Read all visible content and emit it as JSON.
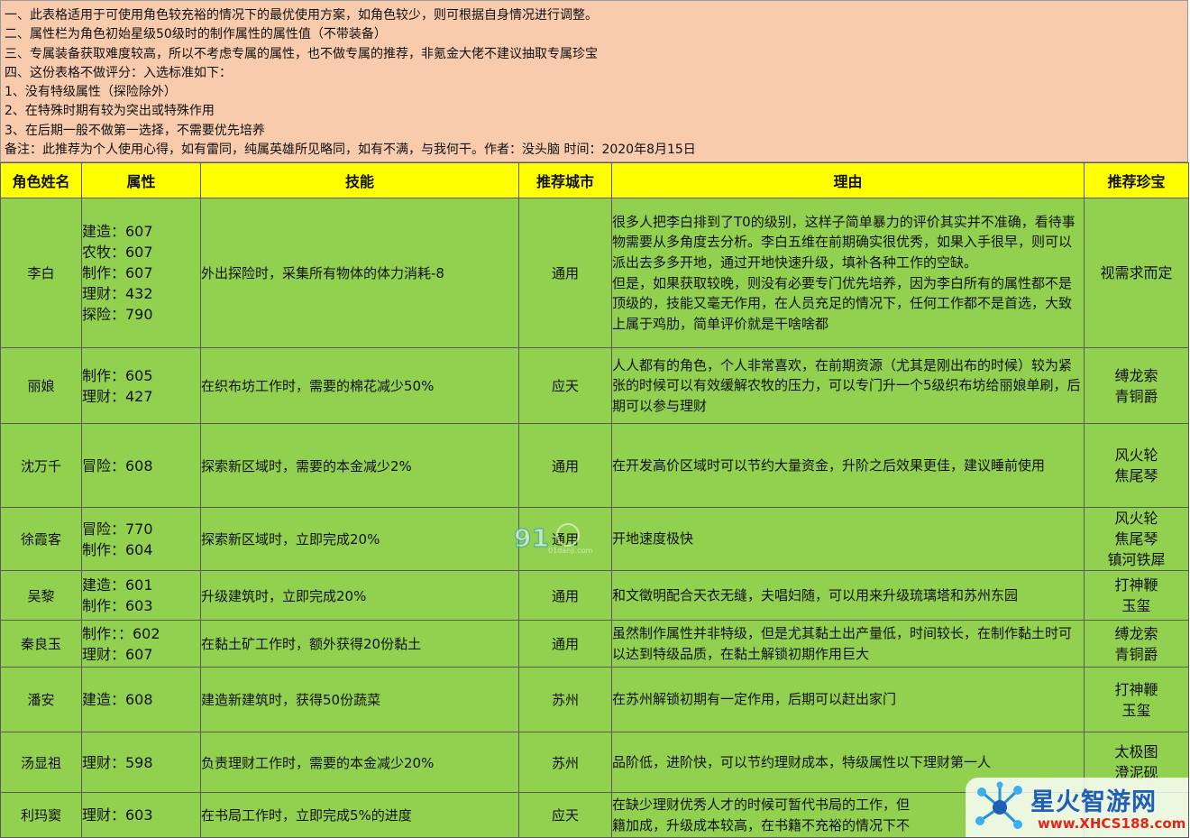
{
  "notes": [
    "一、此表格适用于可使用角色较充裕的情况下的最优使用方案，如角色较少，则可根据自身情况进行调整。",
    "二、属性栏为角色初始星级50级时的制作属性的属性值（不带装备）",
    "三、专属装备获取难度较高，所以不考虑专属的属性，也不做专属的推荐，非氪金大佬不建议抽取专属珍宝",
    "四、这份表格不做评分：入选标准如下：",
    "1、没有特级属性（探险除外）",
    "2、在特殊时期有较为突出或特殊作用",
    "3、在后期一般不做第一选择，不需要优先培养",
    "备注：此推荐为个人使用心得，如有雷同，纯属英雄所见略同，如有不满，与我何干。作者：没头脑  时间：2020年8月15日"
  ],
  "headers": {
    "name": "角色姓名",
    "attr": "属性",
    "skill": "技能",
    "city": "推荐城市",
    "reason": "理由",
    "treasure": "推荐珍宝"
  },
  "rows": [
    {
      "name": "李白",
      "attrs": [
        "建造：607",
        "农牧：607",
        "制作：607",
        "理财：432",
        "探险：790"
      ],
      "skill": "外出探险时，采集所有物体的体力消耗-8",
      "city": "通用",
      "reason": "很多人把李白排到了T0的级别，这样子简单暴力的评价其实并不准确，看待事物需要从多角度去分析。李白五维在前期确实很优秀，如果入手很早，则可以派出去多多开地，通过开地快速升级，填补各种工作的空缺。",
      "reason2": "但是，如果获取较晚，则没有必要专门优先培养，因为李白所有的属性都不是顶级的，技能又毫无作用，在人员充足的情况下，任何工作都不是首选，大致上属于鸡肋，简单评价就是干啥啥都",
      "treasures": [
        "视需求而定"
      ]
    },
    {
      "name": "丽娘",
      "attrs": [
        "制作：605",
        "理财：427"
      ],
      "skill": "在织布坊工作时，需要的棉花减少50%",
      "city": "应天",
      "reason": "人人都有的角色，个人非常喜欢，在前期资源（尤其是刚出布的时候）较为紧张的时候可以有效缓解农牧的压力，可以专门升一个5级织布坊给丽娘单刷，后期可以参与理财",
      "reason2": "",
      "treasures": [
        "缚龙索",
        "青铜爵"
      ]
    },
    {
      "name": "沈万千",
      "attrs": [
        "冒险：608"
      ],
      "skill": "探索新区域时，需要的本金减少2%",
      "city": "通用",
      "reason": "在开发高价区域时可以节约大量资金，升阶之后效果更佳，建议睡前使用",
      "reason2": "",
      "treasures": [
        "风火轮",
        "焦尾琴"
      ]
    },
    {
      "name": "徐霞客",
      "attrs": [
        "冒险：770",
        "制作：604"
      ],
      "skill": "探索新区域时，立即完成20%",
      "city": "通用",
      "reason": "开地速度极快",
      "reason2": "",
      "treasures": [
        "风火轮",
        "焦尾琴",
        "镇河铁犀"
      ]
    },
    {
      "name": "吴黎",
      "attrs": [
        "建造：601",
        "制作：603"
      ],
      "skill": "升级建筑时，立即完成20%",
      "city": "通用",
      "reason": "和文徵明配合天衣无缝，夫唱妇随，可以用来升级琉璃塔和苏州东园",
      "reason2": "",
      "treasures": [
        "打神鞭",
        "玉玺"
      ]
    },
    {
      "name": "秦良玉",
      "attrs": [
        "制作：：602",
        "理财：607"
      ],
      "skill": "在黏土矿工作时，额外获得20份黏土",
      "city": "通用",
      "reason": "虽然制作属性并非特级，但是尤其黏土出产量低，时间较长，在制作黏土时可以达到特级品质，在黏土解锁初期作用巨大",
      "reason2": "",
      "treasures": [
        "缚龙索",
        "青铜爵"
      ]
    },
    {
      "name": "潘安",
      "attrs": [
        "建造：608"
      ],
      "skill": "建造新建筑时，获得50份蔬菜",
      "city": "苏州",
      "reason": "在苏州解锁初期有一定作用，后期可以赶出家门",
      "reason2": "",
      "treasures": [
        "打神鞭",
        "玉玺"
      ]
    },
    {
      "name": "汤显祖",
      "attrs": [
        "理财：598"
      ],
      "skill": "负责理财工作时，需要的本金减少20%",
      "city": "苏州",
      "reason": "品阶低，进阶快，可以节约理财成本，特级属性以下理财第一人",
      "reason2": "",
      "treasures": [
        "太极图",
        "澄泥砚"
      ]
    },
    {
      "name": "利玛窦",
      "attrs": [
        "理财：603"
      ],
      "skill": "在书局工作时，立即完成5%的进度",
      "city": "应天",
      "reason": "在缺少理财优秀人才的时候可暂代书局的工作，但",
      "reason2": "籍加成，升级成本较高，在书籍不充裕的情况下不",
      "treasures": [
        ""
      ]
    }
  ],
  "watermark": {
    "text": "91",
    "sub": "01danji.com"
  },
  "logo": {
    "name": "星火智游网",
    "url": "www.XHCS188.com"
  },
  "colors": {
    "notes_bg": "#f8cbad",
    "header_bg": "#ffff00",
    "row_bg": "#92d050"
  }
}
